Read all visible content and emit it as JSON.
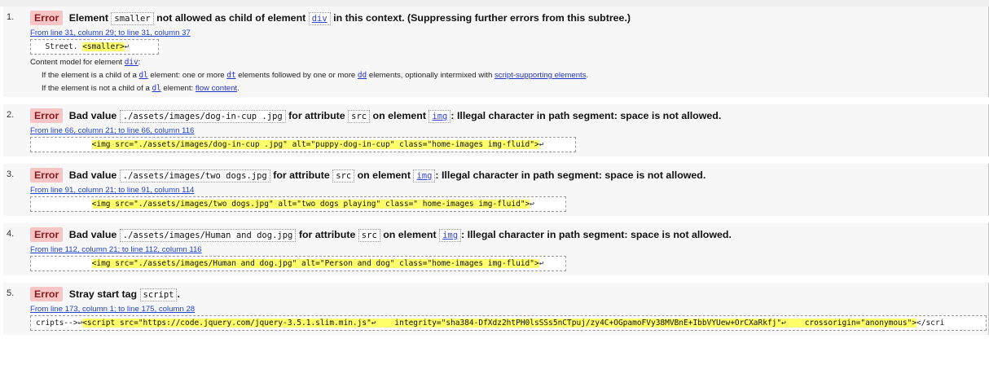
{
  "errors": [
    {
      "num": "1.",
      "badge": "Error",
      "parts": [
        "Element ",
        "smaller",
        " not allowed as child of element ",
        "div",
        " in this context. (Suppressing further errors from this subtree.)"
      ],
      "location": "From line 31, column 29; to line 31, column 37",
      "extract_pre": "  Street. ",
      "extract_hl": "<smaller>",
      "extract_post": "↩",
      "content_model": {
        "title_pre": "Content model for element ",
        "title_code": "div",
        "title_post": ":",
        "row1": [
          "If the element is a child of a ",
          "dl",
          " element: one or more ",
          "dt",
          " elements followed by one or more ",
          "dd",
          " elements, optionally intermixed with ",
          "script-supporting elements",
          "."
        ],
        "row2": [
          "If the element is not a child of a ",
          "dl",
          " element: ",
          "flow content",
          "."
        ]
      }
    },
    {
      "num": "2.",
      "badge": "Error",
      "parts": [
        "Bad value ",
        "./assets/images/dog-in-cup .jpg",
        " for attribute ",
        "src",
        " on element ",
        "img",
        ": Illegal character in path segment: space is not allowed."
      ],
      "location": "From line 66, column 21; to line 66, column 116",
      "extract_pre": "            ",
      "extract_hl": "<img src=\"./assets/images/dog-in-cup .jpg\" alt=\"puppy-dog-in-cup\" class=\"home-images img-fluid\">",
      "extract_post": "↩"
    },
    {
      "num": "3.",
      "badge": "Error",
      "parts": [
        "Bad value ",
        "./assets/images/two dogs.jpg",
        " for attribute ",
        "src",
        " on element ",
        "img",
        ": Illegal character in path segment: space is not allowed."
      ],
      "location": "From line 91, column 21; to line 91, column 114",
      "extract_pre": "            ",
      "extract_hl": "<img src=\"./assets/images/two dogs.jpg\" alt=\"two dogs playing\" class=\" home-images img-fluid\">",
      "extract_post": "↩"
    },
    {
      "num": "4.",
      "badge": "Error",
      "parts": [
        "Bad value ",
        "./assets/images/Human and dog.jpg",
        " for attribute ",
        "src",
        " on element ",
        "img",
        ": Illegal character in path segment: space is not allowed."
      ],
      "location": "From line 112, column 21; to line 112, column 116",
      "extract_pre": "            ",
      "extract_hl": "<img src=\"./assets/images/Human and dog.jpg\" alt=\"Person and dog\" class=\"home-images img-fluid\">",
      "extract_post": "↩"
    },
    {
      "num": "5.",
      "badge": "Error",
      "parts": [
        "Stray start tag ",
        "script",
        "."
      ],
      "location": "From line 173, column 1; to line 175, column 28",
      "extract_pre": "cripts-->↩",
      "extract_hl": "<script src=\"https://code.jquery.com/jquery-3.5.1.slim.min.js\"↩    integrity=\"sha384-DfXdz2htPH0lsSSs5nCTpuj/zy4C+OGpamoFVy38MVBnE+IbbVYUew+OrCXaRkfj\"↩    crossorigin=\"anonymous\">",
      "extract_post": "</scri"
    }
  ]
}
